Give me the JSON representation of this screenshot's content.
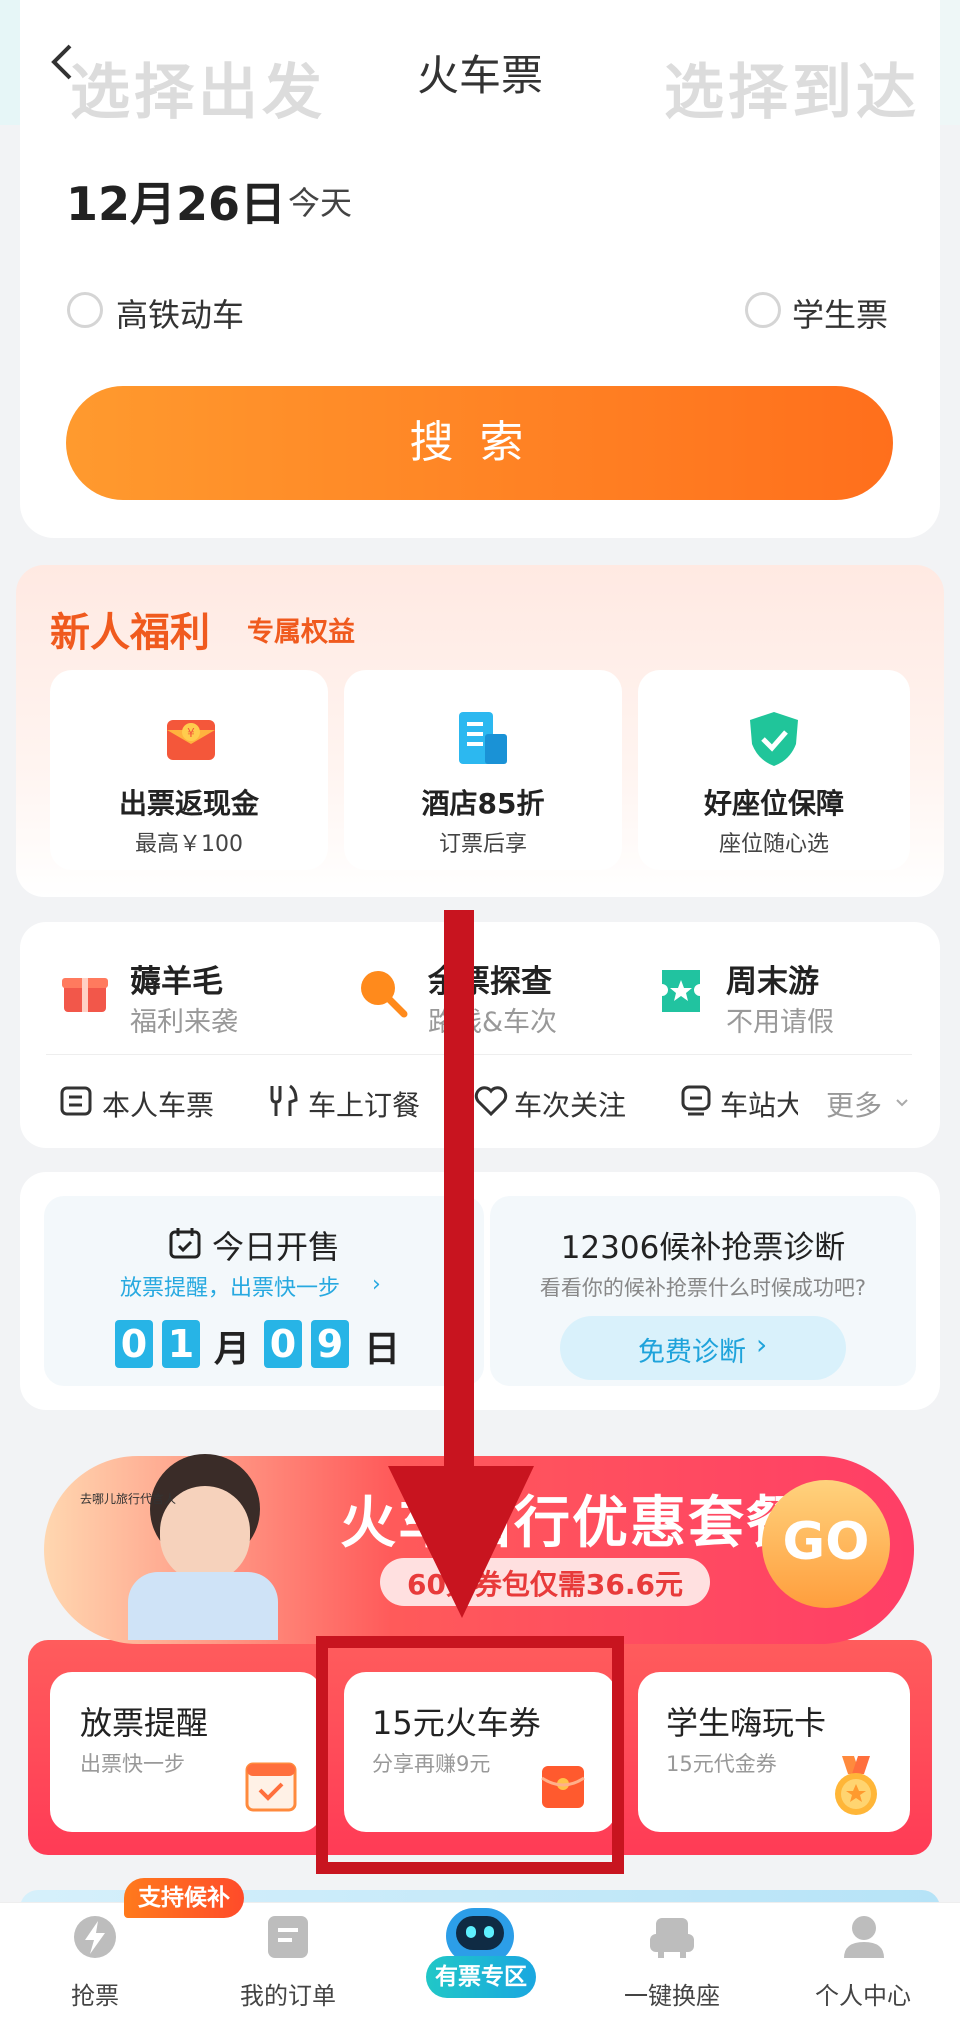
{
  "header": {
    "title": "火车票",
    "from_placeholder": "选择出发",
    "to_placeholder": "选择到达"
  },
  "date": {
    "value": "12月26日",
    "label": "今天"
  },
  "options": {
    "high_speed": "高铁动车",
    "student": "学生票"
  },
  "search": {
    "label": "搜索"
  },
  "newbie": {
    "title": "新人福利",
    "subtitle": "专属权益",
    "items": [
      {
        "title": "出票返现金",
        "sub": "最高￥100",
        "icon": "red-envelope-icon"
      },
      {
        "title": "酒店85折",
        "sub": "订票后享",
        "icon": "hotel-icon"
      },
      {
        "title": "好座位保障",
        "sub": "座位随心选",
        "icon": "shield-check-icon"
      }
    ]
  },
  "features": [
    {
      "title": "薅羊毛",
      "sub": "福利来袭",
      "icon": "gift-icon"
    },
    {
      "title": "余票探查",
      "sub": "路线&车次",
      "icon": "magnifier-icon"
    },
    {
      "title": "周末游",
      "sub": "不用请假",
      "icon": "ticket-star-icon"
    }
  ],
  "quick_links": [
    {
      "label": "本人车票",
      "icon": "id-card-icon"
    },
    {
      "label": "车上订餐",
      "icon": "dining-icon"
    },
    {
      "label": "车次关注",
      "icon": "heart-icon"
    },
    {
      "label": "车站大",
      "icon": "station-icon"
    }
  ],
  "more": {
    "label": "更多"
  },
  "sale": {
    "title": "今日开售",
    "reminder": "放票提醒，出票快一步",
    "digits_month": [
      "0",
      "1"
    ],
    "month_unit": "月",
    "digits_day": [
      "0",
      "9"
    ],
    "day_unit": "日"
  },
  "diagnosis": {
    "title": "12306候补抢票诊断",
    "sub": "看看你的候补抢票什么时候成功吧?",
    "button": "免费诊断"
  },
  "banner": {
    "title": "火车出行优惠套餐",
    "sub": "60元券包仅需36.6元",
    "go": "GO",
    "badge": "去哪儿旅行代言人"
  },
  "promos": [
    {
      "title": "放票提醒",
      "sub": "出票快一步",
      "icon": "calendar-check-icon"
    },
    {
      "title": "15元火车券",
      "sub": "分享再赚9元",
      "icon": "red-envelope-icon"
    },
    {
      "title": "学生嗨玩卡",
      "sub": "15元代金券",
      "icon": "medal-icon"
    }
  ],
  "bottom_nav": [
    {
      "label": "抢票",
      "icon": "lightning-icon"
    },
    {
      "label": "我的订单",
      "icon": "order-icon"
    },
    {
      "label": "有票专区",
      "icon": "robot-icon"
    },
    {
      "label": "一键换座",
      "icon": "seat-icon"
    },
    {
      "label": "个人中心",
      "icon": "person-icon"
    }
  ],
  "nav_badge": "支持候补",
  "colors": {
    "accent": "#ff6f1c",
    "annotation": "#c8141f",
    "teal": "#27b4e6"
  }
}
